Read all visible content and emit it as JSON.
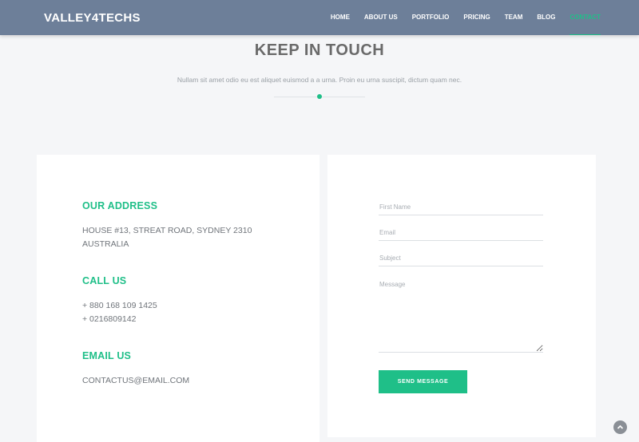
{
  "navbar": {
    "brand": "VALLEY4TECHS",
    "items": [
      {
        "label": "HOME"
      },
      {
        "label": "ABOUT US"
      },
      {
        "label": "PORTFOLIO"
      },
      {
        "label": "PRICING"
      },
      {
        "label": "TEAM"
      },
      {
        "label": "BLOG"
      },
      {
        "label": "CONTACT",
        "active": true
      }
    ]
  },
  "section": {
    "title": "KEEP IN TOUCH",
    "subtitle": "Nullam sit amet odio eu est aliquet euismod a a urna. Proin eu urna suscipit, dictum quam nec."
  },
  "contact_info": {
    "address_heading": "OUR ADDRESS",
    "address_line1": "HOUSE #13, STREAT ROAD, SYDNEY 2310",
    "address_line2": "AUSTRALIA",
    "call_heading": "CALL US",
    "phone1": "+ 880 168 109 1425",
    "phone2": "+ 0216809142",
    "email_heading": "EMAIL US",
    "email": "CONTACTUS@EMAIL.COM"
  },
  "form": {
    "first_name_placeholder": "First Name",
    "first_name_value": "",
    "email_placeholder": "Email",
    "email_value": "",
    "subject_placeholder": "Subject",
    "subject_value": "",
    "message_placeholder": "Message",
    "message_value": "",
    "submit_label": "SEND MESSAGE"
  },
  "icons": {
    "scroll_top": "chevron-up-icon"
  },
  "colors": {
    "accent": "#1fbf88",
    "navbar": "#6d7f99"
  }
}
